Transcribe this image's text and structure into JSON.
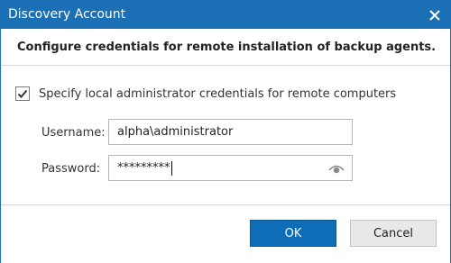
{
  "window": {
    "title": "Discovery Account",
    "close_icon": "close-icon",
    "accent_color": "#1a6fb5"
  },
  "header": {
    "text": "Configure credentials for remote installation of backup agents."
  },
  "credentials": {
    "checkbox_checked": true,
    "checkbox_label": "Specify local administrator credentials for remote computers",
    "username_label": "Username:",
    "username_value": "alpha\\administrator",
    "password_label": "Password:",
    "password_value": "*********",
    "reveal_icon": "eye-icon"
  },
  "footer": {
    "ok_label": "OK",
    "cancel_label": "Cancel"
  }
}
